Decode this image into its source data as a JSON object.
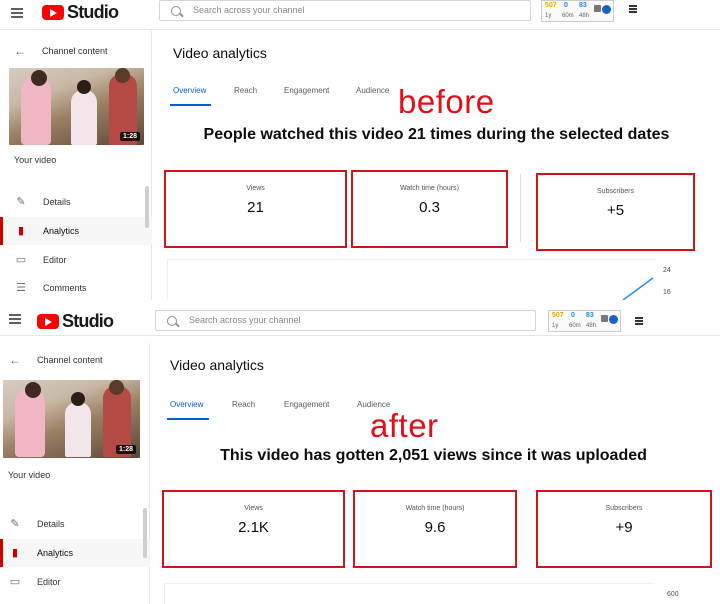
{
  "topbar": {
    "app_name": "Studio",
    "search_placeholder": "Search across your channel",
    "widget": {
      "subs": "507",
      "views": "0",
      "watch": "83",
      "subs_period": "1y",
      "views_period": "60m",
      "watch_period": "48h",
      "subs_color": "#e5a600",
      "views_color": "#1e88e5",
      "watch_color": "#1e88e5"
    }
  },
  "sidebar": {
    "back_label": "Channel content",
    "thumbnail_duration": "1:28",
    "your_video": "Your video",
    "items": [
      {
        "label": "Details",
        "icon": "pencil-icon"
      },
      {
        "label": "Analytics",
        "icon": "analytics-icon"
      },
      {
        "label": "Editor",
        "icon": "editor-icon"
      },
      {
        "label": "Comments",
        "icon": "comments-icon"
      }
    ]
  },
  "main": {
    "title": "Video analytics",
    "tabs": [
      "Overview",
      "Reach",
      "Engagement",
      "Audience"
    ]
  },
  "before": {
    "overlay": "before",
    "headline": "People watched this video 21 times during the selected dates",
    "cards": [
      {
        "label": "Views",
        "value": "21"
      },
      {
        "label": "Watch time (hours)",
        "value": "0.3"
      },
      {
        "label": "Subscribers",
        "value": "+5"
      }
    ],
    "axis_ticks": [
      "24",
      "16"
    ]
  },
  "after": {
    "overlay": "after",
    "headline": "This video has gotten 2,051 views since it was uploaded",
    "cards": [
      {
        "label": "Views",
        "value": "2.1K"
      },
      {
        "label": "Watch time (hours)",
        "value": "9.6"
      },
      {
        "label": "Subscribers",
        "value": "+9"
      }
    ],
    "axis_ticks": [
      "600"
    ]
  },
  "colors": {
    "brand_red": "#ff0000",
    "highlight_red": "#d0141b",
    "accent_blue": "#065fd4"
  }
}
